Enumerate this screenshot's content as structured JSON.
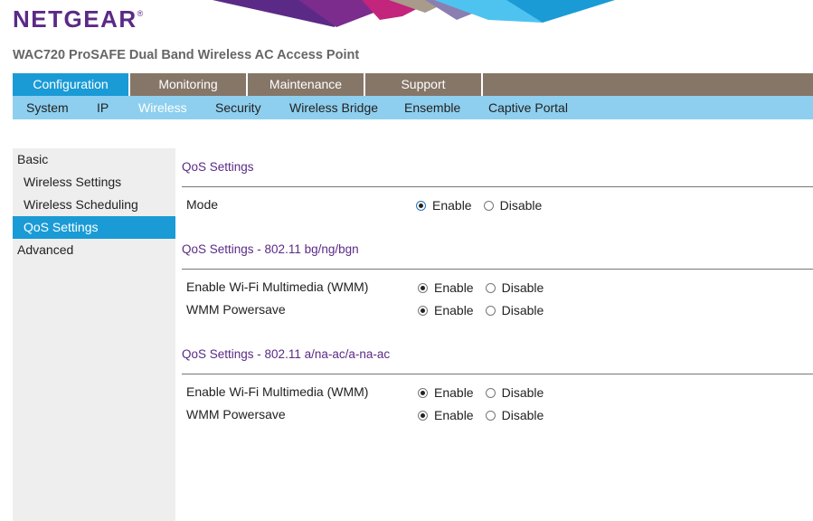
{
  "brand": {
    "logo_text": "NETGEAR",
    "trademark": "®"
  },
  "product_title": "WAC720 ProSAFE Dual Band Wireless AC Access Point",
  "main_nav": [
    {
      "label": "Configuration",
      "active": true
    },
    {
      "label": "Monitoring",
      "active": false
    },
    {
      "label": "Maintenance",
      "active": false
    },
    {
      "label": "Support",
      "active": false
    }
  ],
  "sub_nav": [
    {
      "label": "System",
      "active": false
    },
    {
      "label": "IP",
      "active": false
    },
    {
      "label": "Wireless",
      "active": true
    },
    {
      "label": "Security",
      "active": false
    },
    {
      "label": "Wireless Bridge",
      "active": false
    },
    {
      "label": "Ensemble",
      "active": false
    },
    {
      "label": "Captive Portal",
      "active": false
    }
  ],
  "sidebar": [
    {
      "label": "Basic",
      "type": "group",
      "active": false
    },
    {
      "label": "Wireless Settings",
      "type": "sub",
      "active": false
    },
    {
      "label": "Wireless Scheduling",
      "type": "sub",
      "active": false
    },
    {
      "label": "QoS Settings",
      "type": "sub",
      "active": true
    },
    {
      "label": "Advanced",
      "type": "group",
      "active": false
    }
  ],
  "radio_labels": {
    "enable": "Enable",
    "disable": "Disable"
  },
  "sections": [
    {
      "title": "QoS Settings",
      "rows": [
        {
          "label": "Mode",
          "value": "Enable"
        }
      ]
    },
    {
      "title": "QoS Settings - 802.11 bg/ng/bgn",
      "rows": [
        {
          "label": "Enable Wi-Fi Multimedia (WMM)",
          "value": "Enable"
        },
        {
          "label": "WMM Powersave",
          "value": "Enable"
        }
      ]
    },
    {
      "title": "QoS Settings - 802.11 a/na-ac/a-na-ac",
      "rows": [
        {
          "label": "Enable Wi-Fi Multimedia (WMM)",
          "value": "Enable"
        },
        {
          "label": "WMM Powersave",
          "value": "Enable"
        }
      ]
    }
  ],
  "colors": {
    "brand_purple": "#5b2a86",
    "nav_brown": "#867668",
    "active_blue": "#1a9bd6",
    "subnav_blue": "#8ecfef"
  }
}
